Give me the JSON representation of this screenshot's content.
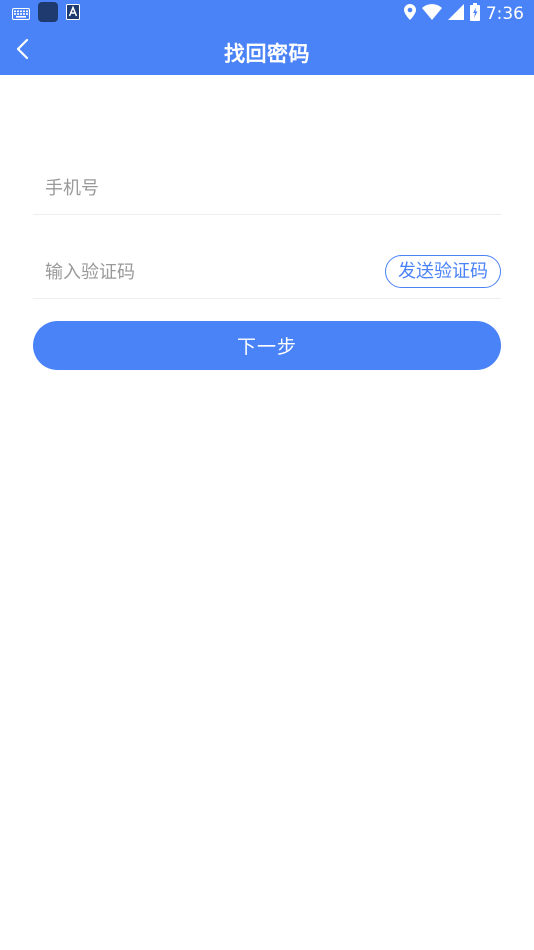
{
  "status_bar": {
    "time": "7:36",
    "left_icons": [
      "keyboard-icon",
      "app-square-icon",
      "a-letter-icon"
    ],
    "right_icons": [
      "location-icon",
      "wifi-icon",
      "signal-icon",
      "battery-icon"
    ]
  },
  "nav": {
    "title": "找回密码",
    "back_icon": "chevron-left-icon"
  },
  "form": {
    "phone": {
      "placeholder": "手机号",
      "value": ""
    },
    "code": {
      "placeholder": "输入验证码",
      "value": ""
    },
    "send_code_label": "发送验证码",
    "next_label": "下一步"
  },
  "colors": {
    "primary": "#4a82f7",
    "placeholder": "#999999",
    "divider": "#eeeeee"
  }
}
